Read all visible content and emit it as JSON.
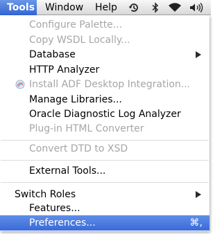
{
  "menubar": {
    "tools": "Tools",
    "window": "Window",
    "help": "Help",
    "status_icons": [
      "time-machine-icon",
      "bluetooth-icon",
      "wifi-icon",
      "volume-icon"
    ]
  },
  "menu": {
    "items": [
      {
        "label": "Configure Palette...",
        "enabled": false
      },
      {
        "label": "Copy WSDL Locally...",
        "enabled": false
      },
      {
        "label": "Database",
        "enabled": true,
        "submenu": true
      },
      {
        "label": "HTTP Analyzer",
        "enabled": true
      },
      {
        "label": "Install ADF Desktop Integration...",
        "enabled": false,
        "icon": "adf-icon"
      },
      {
        "label": "Manage Libraries...",
        "enabled": true
      },
      {
        "label": "Oracle Diagnostic Log Analyzer",
        "enabled": true
      },
      {
        "label": "Plug-in HTML Converter",
        "enabled": false
      },
      {
        "label": "Convert DTD to XSD",
        "enabled": false
      },
      {
        "label": "External Tools...",
        "enabled": true
      },
      {
        "label": "Switch Roles",
        "enabled": true,
        "submenu": true
      },
      {
        "label": "Features...",
        "enabled": true
      },
      {
        "label": "Preferences...",
        "enabled": true,
        "selected": true,
        "shortcut": "⌘,"
      }
    ]
  },
  "colors": {
    "highlight": "#3a6ad8",
    "disabled_text": "#a6a6a6"
  }
}
